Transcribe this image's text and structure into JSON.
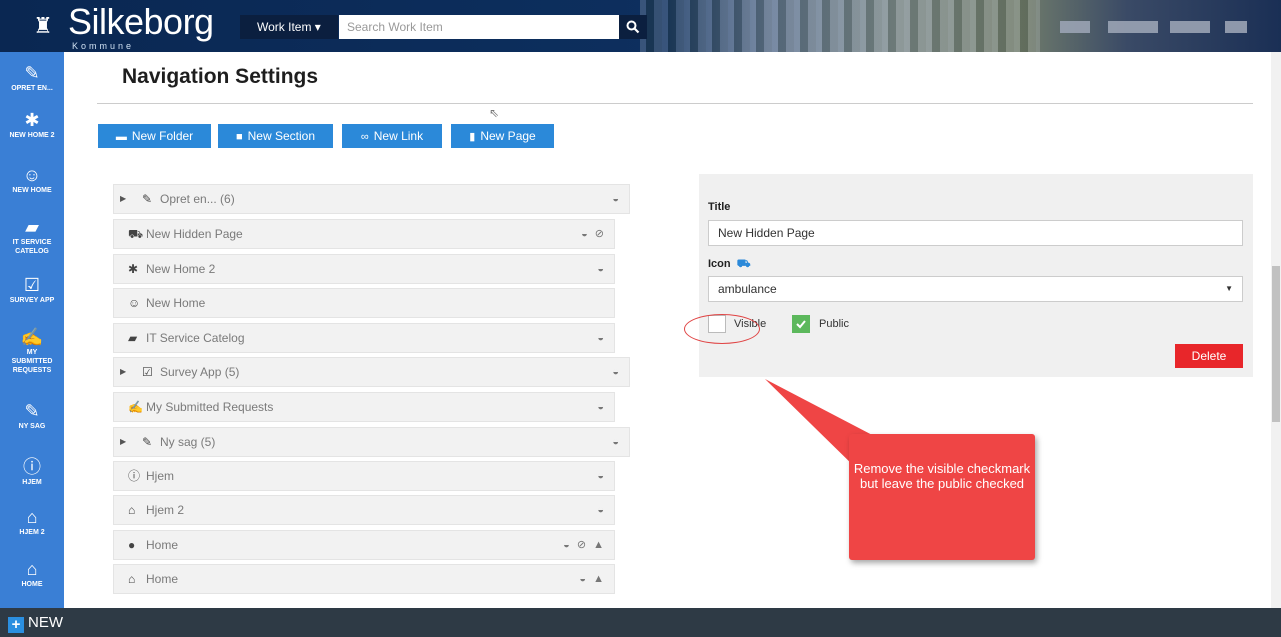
{
  "header": {
    "logo_name": "Silkeborg",
    "logo_sub": "Kommune",
    "work_item_label": "Work Item ▾",
    "search_placeholder": "Search Work Item",
    "search_icon": "search-icon"
  },
  "sidebar": {
    "items": [
      {
        "label": "OPRET EN...",
        "icon": "pencil-icon"
      },
      {
        "label": "NEW HOME 2",
        "icon": "asterisk-icon"
      },
      {
        "label": "NEW HOME",
        "icon": "smile-icon"
      },
      {
        "label": "IT SERVICE CATELOG",
        "icon": "book-icon"
      },
      {
        "label": "SURVEY APP",
        "icon": "check-square-icon"
      },
      {
        "label": "MY SUBMITTED REQUESTS",
        "icon": "edit-icon"
      },
      {
        "label": "NY SAG",
        "icon": "pencil-icon"
      },
      {
        "label": "HJEM",
        "icon": "info-icon"
      },
      {
        "label": "HJEM 2",
        "icon": "home-icon"
      },
      {
        "label": "HOME",
        "icon": "home-icon"
      }
    ]
  },
  "bottom_bar": {
    "new_label": "NEW"
  },
  "main": {
    "title": "Navigation Settings",
    "toolbar": {
      "new_folder": "New Folder",
      "new_section": "New Section",
      "new_link": "New Link",
      "new_page": "New Page"
    },
    "nav_items": [
      {
        "label": "Opret en... (6)",
        "icon": "pencil-icon",
        "expandable": true,
        "status": "◒"
      },
      {
        "label": "New Hidden Page",
        "icon": "ambulance-icon",
        "expandable": false,
        "status": "◒ ⊘"
      },
      {
        "label": "New Home 2",
        "icon": "asterisk-icon",
        "expandable": false,
        "status": "◒"
      },
      {
        "label": "New Home",
        "icon": "smile-icon",
        "expandable": false,
        "status": ""
      },
      {
        "label": "IT Service Catelog",
        "icon": "book-icon",
        "expandable": false,
        "status": "◒"
      },
      {
        "label": "Survey App (5)",
        "icon": "check-square-icon",
        "expandable": true,
        "status": "◒"
      },
      {
        "label": "My Submitted Requests",
        "icon": "edit-icon",
        "expandable": false,
        "status": "◒"
      },
      {
        "label": "Ny sag (5)",
        "icon": "pencil-icon",
        "expandable": true,
        "status": "◒"
      },
      {
        "label": "Hjem",
        "icon": "info-icon",
        "expandable": false,
        "status": "◒"
      },
      {
        "label": "Hjem 2",
        "icon": "home-icon",
        "expandable": false,
        "status": "◒"
      },
      {
        "label": "Home",
        "icon": "bomb-icon",
        "expandable": false,
        "status": "◒ ⊘ ▲"
      },
      {
        "label": "Home",
        "icon": "home-icon",
        "expandable": false,
        "status": "◒ ▲"
      }
    ]
  },
  "panel": {
    "title_label": "Title",
    "title_value": "New Hidden Page",
    "icon_label": "Icon",
    "icon_value": "ambulance",
    "visible_label": "Visible",
    "visible_checked": false,
    "public_label": "Public",
    "public_checked": true,
    "delete_label": "Delete"
  },
  "callout": {
    "text": "Remove the visible checkmark but leave the public checked",
    "color": "#ef4545"
  },
  "colors": {
    "sidebar": "#3a7fd5",
    "button": "#2b89d9",
    "delete": "#e8262a",
    "check_on": "#5cb85c"
  }
}
